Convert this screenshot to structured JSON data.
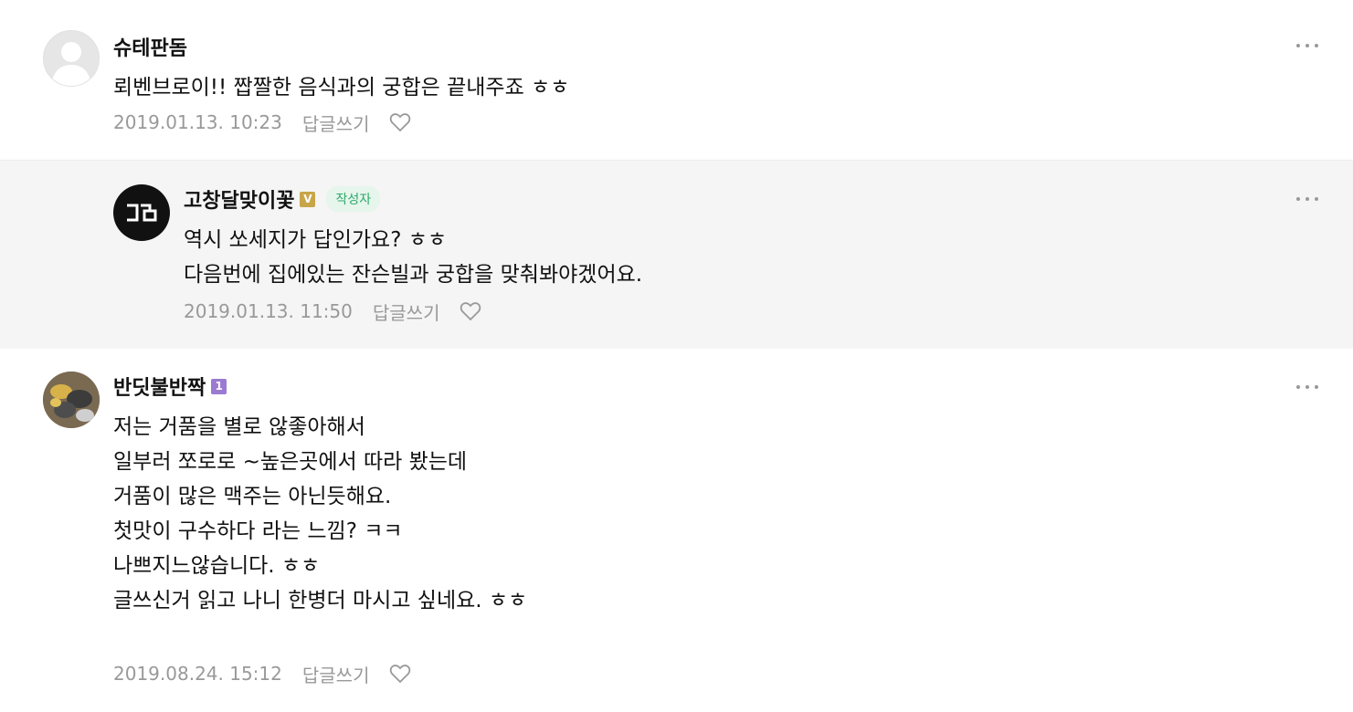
{
  "comments": [
    {
      "name": "슈테판돔",
      "lines": [
        "뢰벤브로이!! 짭짤한 음식과의 궁합은 끝내주죠 ㅎㅎ"
      ],
      "date": "2019.01.13. 10:23",
      "reply_label": "답글쓰기"
    },
    {
      "name": "고창달맞이꽃",
      "badge": "V",
      "author_tag": "작성자",
      "lines": [
        "역시 쏘세지가 답인가요? ㅎㅎ",
        "다음번에 집에있는 잔슨빌과 궁합을 맞춰봐야겠어요."
      ],
      "date": "2019.01.13. 11:50",
      "reply_label": "답글쓰기"
    },
    {
      "name": "반딧불반짝",
      "badge": "1",
      "lines": [
        "저는 거품을 별로 않좋아해서",
        "일부러 쪼로로 ~높은곳에서 따라 봤는데",
        "거품이 많은 맥주는 아닌듯해요.",
        "첫맛이 구수하다 라는 느낌? ㅋㅋ",
        "나쁘지느않습니다. ㅎㅎ",
        "글쓰신거 읽고 나니 한병더 마시고 싶네요. ㅎㅎ"
      ],
      "date": "2019.08.24. 15:12",
      "reply_label": "답글쓰기"
    }
  ]
}
